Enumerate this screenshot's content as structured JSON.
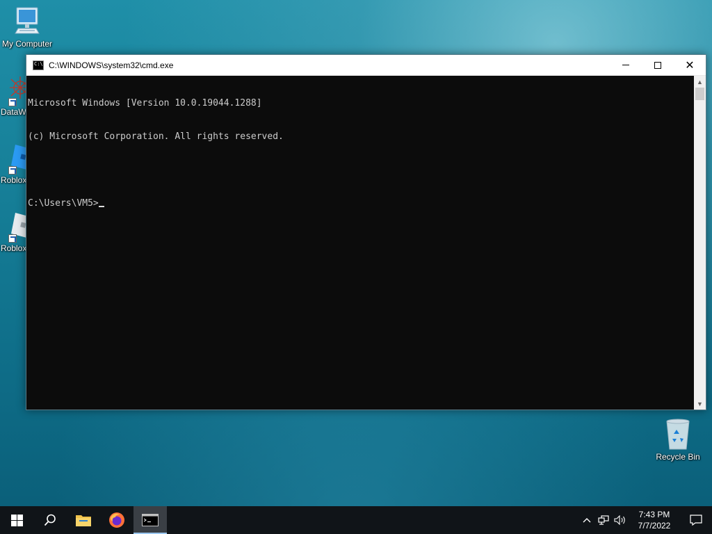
{
  "desktop": {
    "icons": [
      {
        "label": "My Computer"
      },
      {
        "label": "DataW"
      },
      {
        "label": "Roblox"
      },
      {
        "label": "Roblox"
      },
      {
        "label": "Recycle Bin"
      }
    ]
  },
  "cmd_window": {
    "title": "C:\\WINDOWS\\system32\\cmd.exe",
    "lines": [
      "Microsoft Windows [Version 10.0.19044.1288]",
      "(c) Microsoft Corporation. All rights reserved.",
      ""
    ],
    "prompt": "C:\\Users\\VM5>",
    "icons": {
      "minimize": "minimize-icon",
      "maximize": "maximize-icon",
      "close": "close-icon"
    }
  },
  "taskbar": {
    "items": [
      "start-icon",
      "search-icon",
      "file-explorer-icon",
      "firefox-icon",
      "cmd-icon"
    ],
    "clock": {
      "time": "7:43 PM",
      "date": "7/7/2022"
    },
    "tray": [
      "chevron-up-icon",
      "network-icon",
      "volume-icon",
      "notification-icon"
    ]
  },
  "colors": {
    "console_bg": "#0c0c0c",
    "console_text": "#cccccc",
    "taskbar_bg": "#101418"
  }
}
